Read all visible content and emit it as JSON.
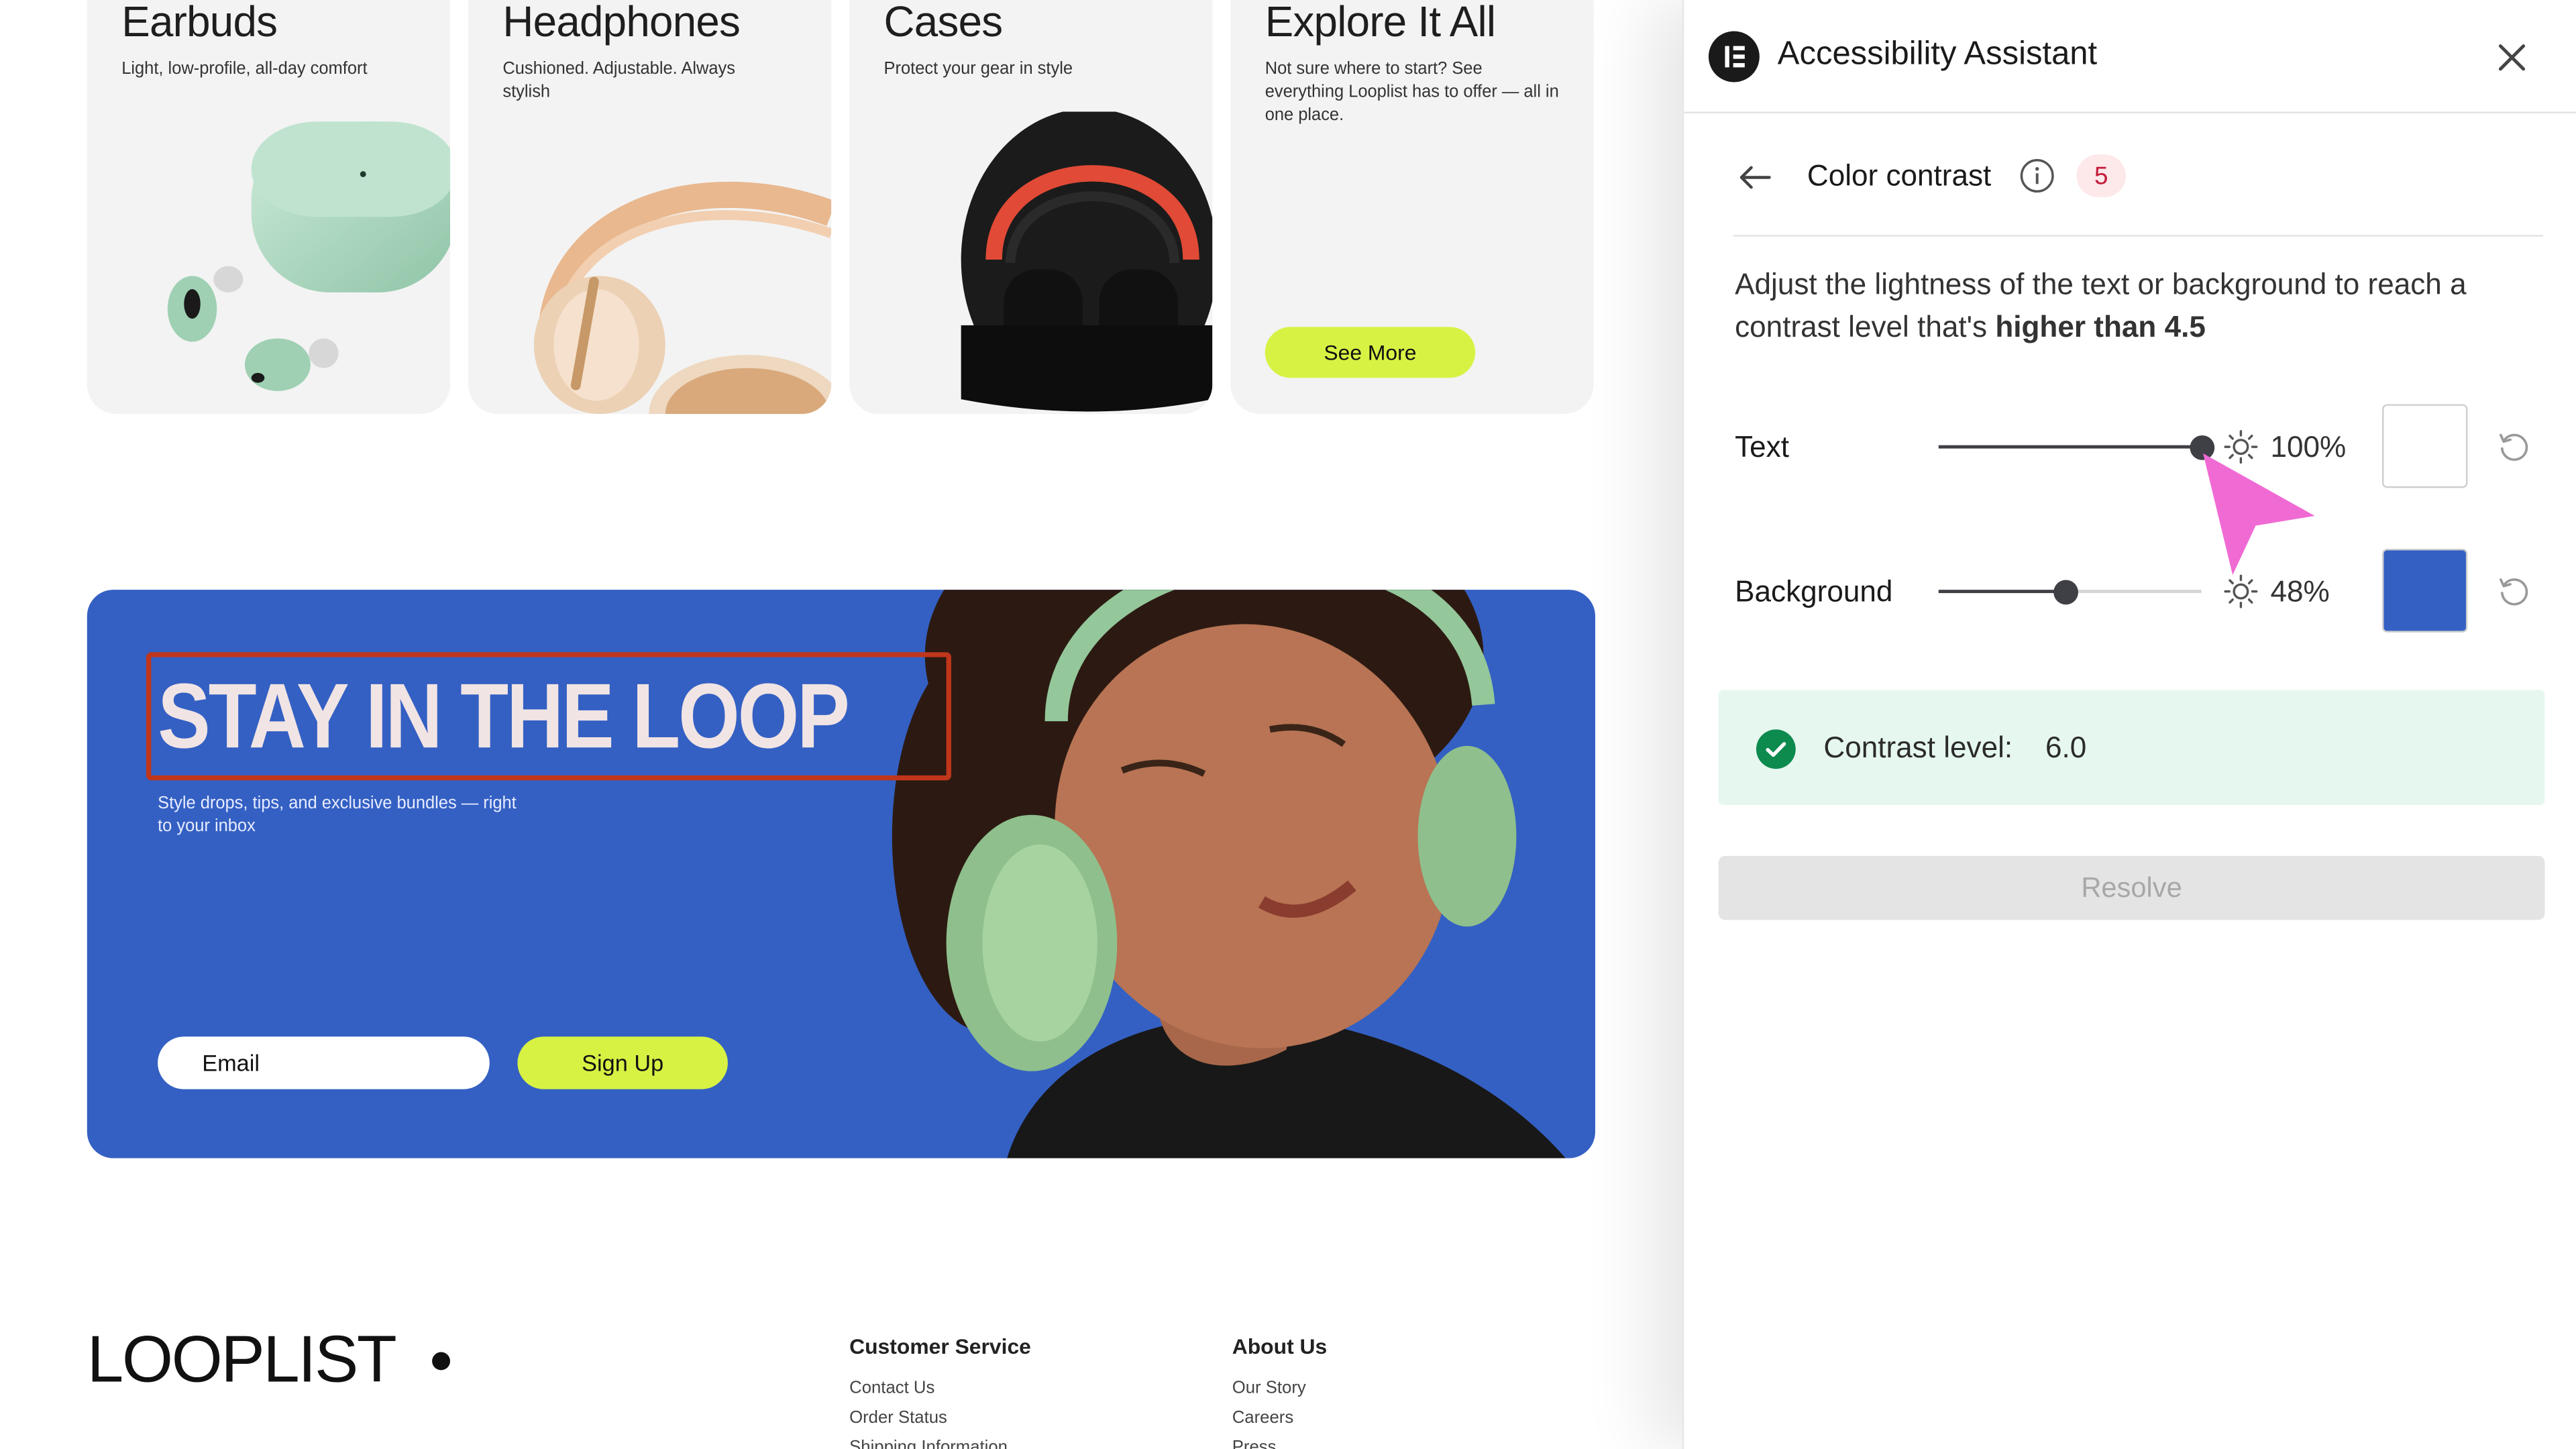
{
  "products": [
    {
      "title": "Earbuds",
      "subtitle": "Light, low-profile, all-day comfort"
    },
    {
      "title": "Headphones",
      "subtitle": "Cushioned. Adjustable. Always stylish"
    },
    {
      "title": "Cases",
      "subtitle": "Protect your gear in style"
    },
    {
      "title": "Explore It All",
      "subtitle": "Not sure where to start? See everything Looplist has to offer — all in one place.",
      "button": "See More"
    }
  ],
  "newsletter": {
    "headline": "STAY IN THE LOOP",
    "subtext": "Style drops, tips, and exclusive bundles — right to your inbox",
    "email_placeholder": "Email",
    "signup_label": "Sign Up"
  },
  "footer": {
    "logo": "LOOPLIST",
    "columns": [
      {
        "title": "Customer Service",
        "links": [
          "Contact Us",
          "Order Status",
          "Shipping Information"
        ]
      },
      {
        "title": "About Us",
        "links": [
          "Our Story",
          "Careers",
          "Press"
        ]
      }
    ]
  },
  "panel": {
    "title": "Accessibility Assistant",
    "section_title": "Color contrast",
    "issue_count": "5",
    "description": "Adjust the lightness of the text or background to reach a contrast level that's ",
    "description_bold": "higher than 4.5",
    "text_control": {
      "label": "Text",
      "percent_label": "100%",
      "value": 1.0,
      "color": "#ffffff"
    },
    "background_control": {
      "label": "Background",
      "percent_label": "48%",
      "value": 0.48,
      "color": "#3460c3"
    },
    "result_label": "Contrast level:",
    "result_value": "6.0",
    "resolve_label": "Resolve"
  },
  "colors": {
    "accent_lime": "#d8f244",
    "banner_blue": "#3460c3",
    "highlight_red": "#c0361b",
    "success_green": "#0d8a4e",
    "cursor_pink": "#f06ad4"
  },
  "icons": [
    "elementor-logo-icon",
    "close-icon",
    "back-arrow-icon",
    "info-icon",
    "brightness-icon",
    "reset-icon",
    "check-icon",
    "mouse-pointer-icon"
  ]
}
